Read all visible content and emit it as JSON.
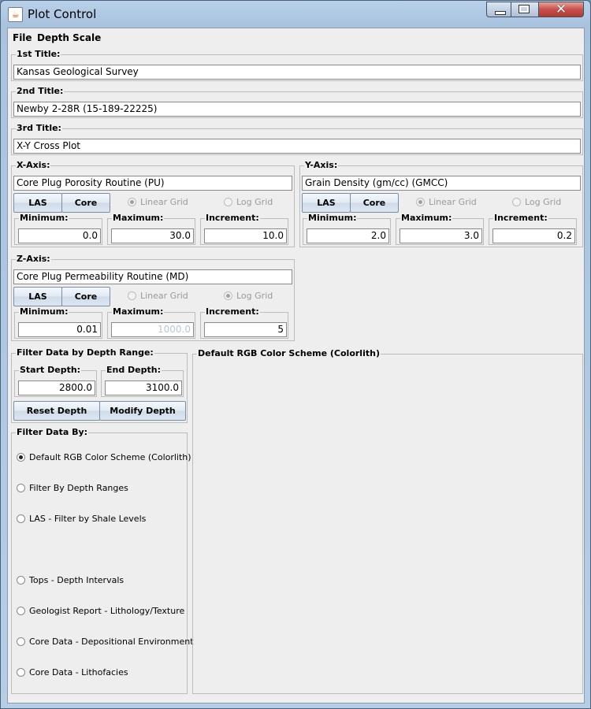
{
  "window": {
    "title": "Plot Control"
  },
  "menu": [
    "File",
    "Depth Scale"
  ],
  "titles": [
    {
      "legend": "1st Title:",
      "value": "Kansas Geological Survey"
    },
    {
      "legend": "2nd Title:",
      "value": "Newby 2-28R (15-189-22225)"
    },
    {
      "legend": "3rd Title:",
      "value": "X-Y Cross Plot"
    }
  ],
  "xaxis": {
    "legend": "X-Axis:",
    "variable": "Core Plug Porosity Routine (PU)",
    "las": "LAS",
    "core": "Core",
    "linear": "Linear Grid",
    "log": "Log Grid",
    "min_label": "Minimum:",
    "min": "0.0",
    "max_label": "Maximum:",
    "max": "30.0",
    "inc_label": "Increment:",
    "inc": "10.0"
  },
  "yaxis": {
    "legend": "Y-Axis:",
    "variable": "Grain Density (gm/cc) (GMCC)",
    "las": "LAS",
    "core": "Core",
    "linear": "Linear Grid",
    "log": "Log Grid",
    "min_label": "Minimum:",
    "min": "2.0",
    "max_label": "Maximum:",
    "max": "3.0",
    "inc_label": "Increment:",
    "inc": "0.2"
  },
  "zaxis": {
    "legend": "Z-Axis:",
    "variable": "Core Plug Permeability Routine (MD)",
    "las": "LAS",
    "core": "Core",
    "linear": "Linear Grid",
    "log": "Log Grid",
    "min_label": "Minimum:",
    "min": "0.01",
    "max_label": "Maximum:",
    "max": "1000.0",
    "inc_label": "Increment:",
    "inc": "5"
  },
  "depth_filter": {
    "legend": "Filter Data by Depth Range:",
    "start_label": "Start Depth:",
    "start": "2800.0",
    "end_label": "End Depth:",
    "end": "3100.0",
    "reset": "Reset Depth",
    "modify": "Modify Depth"
  },
  "filter_by": {
    "legend": "Filter Data By:",
    "options": [
      "Default RGB Color Scheme (Colorlith)",
      "Filter By Depth Ranges",
      "LAS - Filter by Shale Levels",
      "Tops - Depth Intervals",
      "Geologist Report - Lithology/Texture",
      "Core Data - Depositional Environment",
      "Core Data - Lithofacies"
    ]
  },
  "color_panel": {
    "legend": "Default RGB Color Scheme (Colorlith)"
  }
}
